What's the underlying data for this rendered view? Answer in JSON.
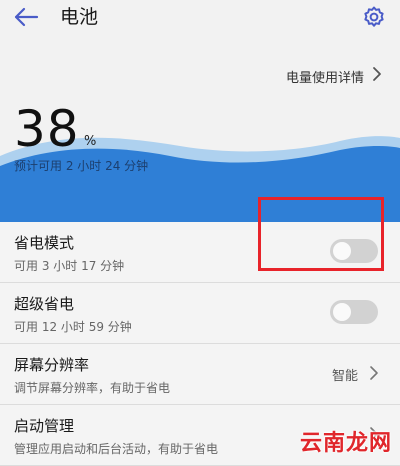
{
  "header": {
    "title": "电池",
    "back_icon": "arrow-left-icon",
    "settings_icon": "gear-icon"
  },
  "hero": {
    "detail_link": "电量使用详情",
    "percent": "38",
    "percent_sign": "%",
    "estimate": "预计可用 2 小时 24 分钟"
  },
  "rows": [
    {
      "title": "省电模式",
      "subtitle": "可用 3 小时 17 分钟",
      "toggle_on": false
    },
    {
      "title": "超级省电",
      "subtitle": "可用 12 小时 59 分钟",
      "toggle_on": false
    },
    {
      "title": "屏幕分辨率",
      "subtitle": "调节屏幕分辨率，有助于省电",
      "value": "智能"
    },
    {
      "title": "启动管理",
      "subtitle": "管理应用启动和后台活动，有助于省电"
    }
  ],
  "watermark": "云南龙网",
  "colors": {
    "accent": "#4a5cc8",
    "wave_dark": "#2f7fd6",
    "wave_light": "#9cc8ee",
    "highlight": "#e8232a",
    "toggle_off": "#d2d2d2"
  }
}
